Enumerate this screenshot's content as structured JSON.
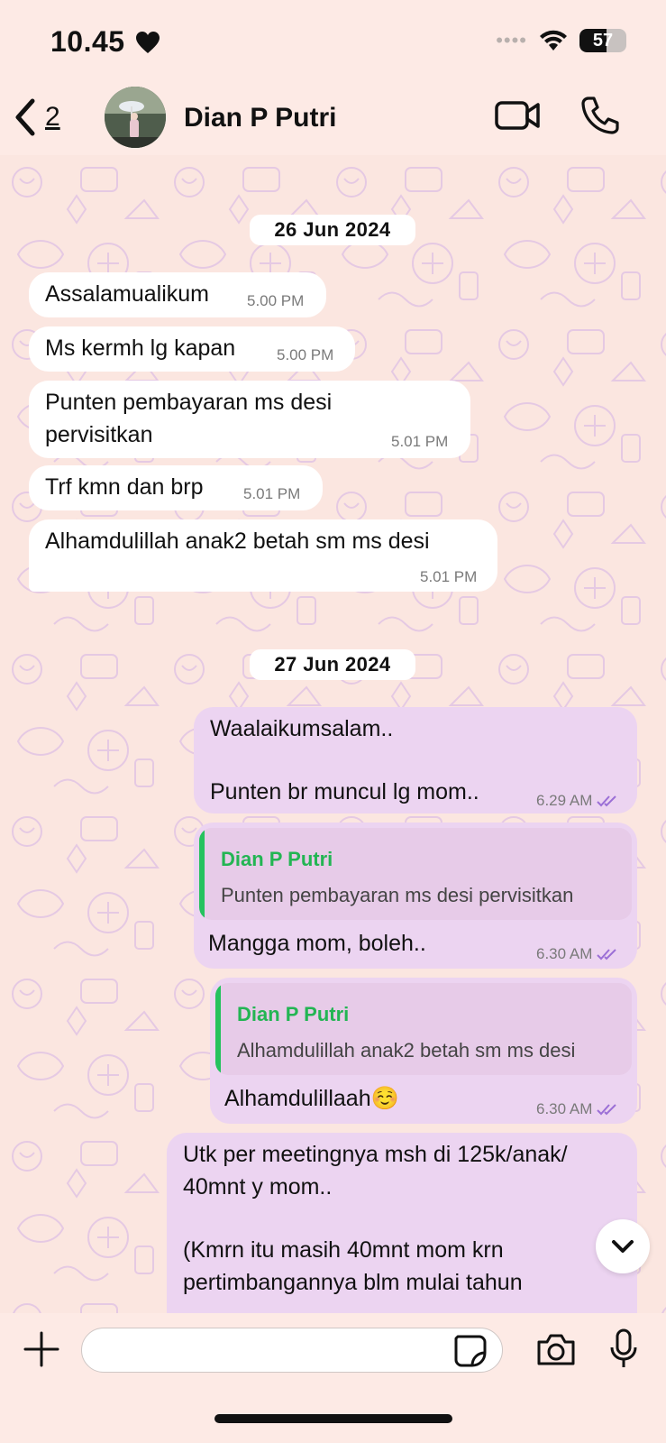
{
  "status_bar": {
    "time": "10.45",
    "heart_icon": "heart-icon",
    "battery_level": "57",
    "battery_fraction": 0.57
  },
  "header": {
    "back_count": "2",
    "contact_name": "Dian P Putri"
  },
  "chat": {
    "dates": [
      "26 Jun 2024",
      "27 Jun 2024"
    ],
    "incoming": [
      {
        "text": "Assalamualikum",
        "time": "5.00 PM"
      },
      {
        "text": "Ms kermh lg kapan",
        "time": "5.00 PM"
      },
      {
        "line1": "Punten pembayaran ms desi",
        "line2": "pervisitkan",
        "time": "5.01 PM"
      },
      {
        "text": "Trf kmn dan brp",
        "time": "5.01 PM"
      },
      {
        "text": "Alhamdulillah anak2 betah sm ms desi",
        "time": "5.01 PM"
      }
    ],
    "outgoing": [
      {
        "line1": "Waalaikumsalam..",
        "line2": "Punten br muncul lg mom..",
        "time": "6.29 AM"
      },
      {
        "reply_author": "Dian P Putri",
        "reply_text": "Punten pembayaran ms desi pervisitkan",
        "text": "Mangga mom, boleh..",
        "time": "6.30 AM"
      },
      {
        "reply_author": "Dian P Putri",
        "reply_text": "Alhamdulillah anak2 betah sm ms desi",
        "text": "Alhamdulillaah☺️",
        "time": "6.30 AM"
      },
      {
        "line1": "Utk per meetingnya msh di 125k/anak/",
        "line2": "40mnt y mom..",
        "line3": "(Kmrn itu masih 40mnt mom krn",
        "line4": "pertimbangannya blm mulai tahun"
      }
    ]
  },
  "input": {
    "placeholder": ""
  },
  "colors": {
    "wallpaper": "#fbe6e0",
    "outgoing_bubble": "#ecd4f1",
    "incoming_bubble": "#ffffff",
    "reply_accent": "#25c25e",
    "read_ticks": "#9b6fd6"
  }
}
